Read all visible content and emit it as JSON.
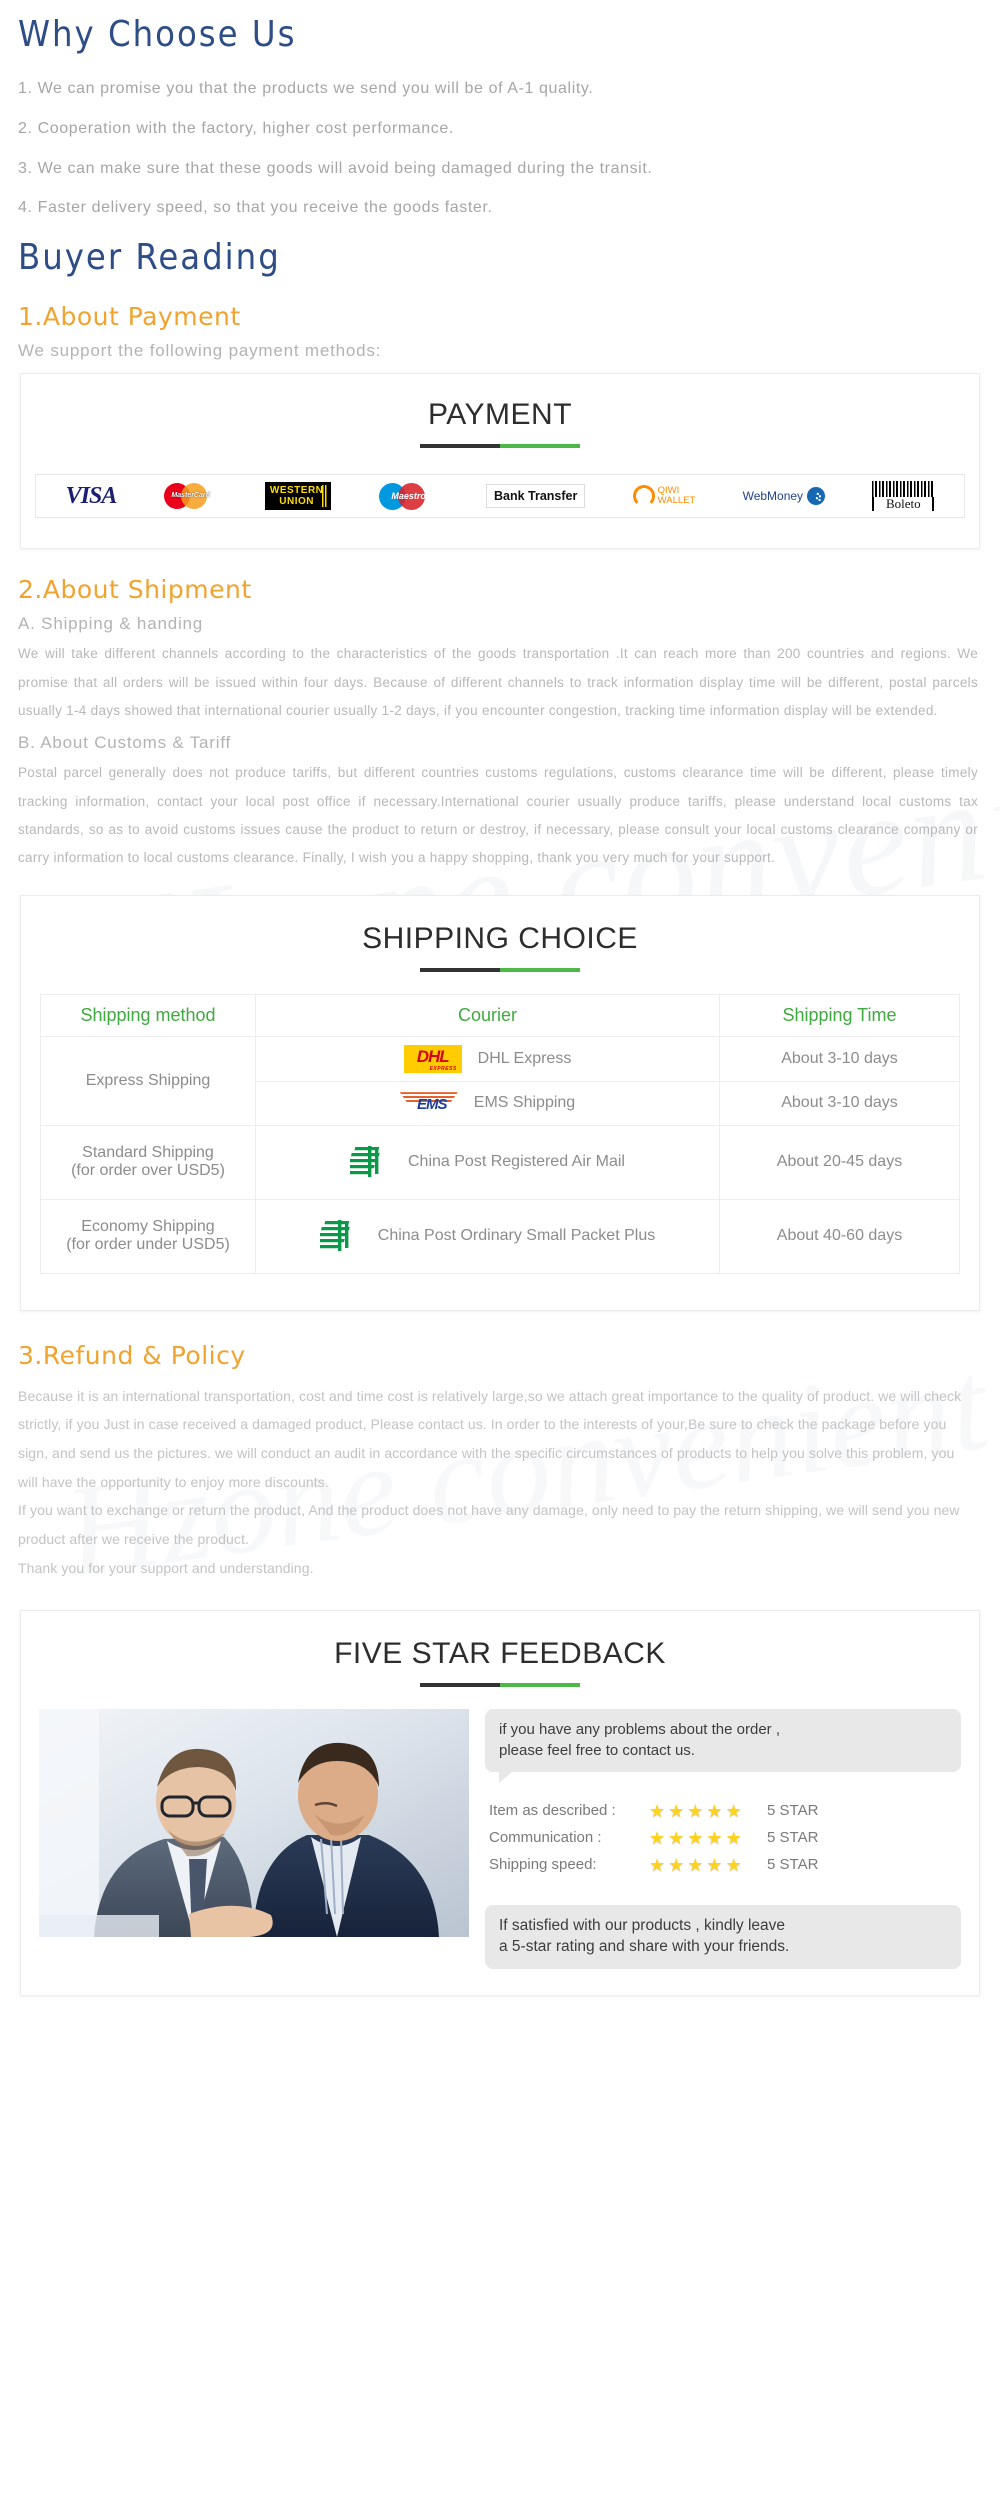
{
  "watermark": {
    "line1": "Hzone convenient life store",
    "line2": "Hzone convenient life store"
  },
  "why_choose_us": {
    "title": "Why Choose Us",
    "items": [
      "1. We can promise you that the products we send you will be of A-1 quality.",
      "2. Cooperation with the factory, higher cost performance.",
      "3. We can make sure that these goods will avoid being damaged during the transit.",
      "4. Faster delivery speed, so that you receive the goods faster."
    ]
  },
  "buyer_reading": {
    "title": "Buyer Reading"
  },
  "payment": {
    "heading": "1.About Payment",
    "intro": "We support the following payment methods:",
    "panel_title": "PAYMENT",
    "methods": [
      {
        "name": "visa-logo",
        "label": "VISA"
      },
      {
        "name": "mastercard-logo",
        "label": "MasterCard"
      },
      {
        "name": "western-union-logo",
        "label_line1": "WESTERN",
        "label_line2": "UNION"
      },
      {
        "name": "maestro-logo",
        "label": "Maestro"
      },
      {
        "name": "bank-transfer-logo",
        "label": "Bank Transfer"
      },
      {
        "name": "qiwi-wallet-logo",
        "label_line1": "QIWI",
        "label_line2": "WALLET"
      },
      {
        "name": "webmoney-logo",
        "label": "WebMoney"
      },
      {
        "name": "boleto-logo",
        "label": "Boleto"
      }
    ]
  },
  "shipment": {
    "heading": "2.About Shipment",
    "section_a_title": "A. Shipping & handing",
    "section_a_text": "We will take different channels according to the characteristics of the goods transportation .It can reach more than 200 countries and regions. We promise that all orders will be issued within four days. Because of different channels to track information display time will be different, postal parcels usually 1-4 days showed that international courier usually 1-2 days, if you encounter congestion, tracking time information display will be extended.",
    "section_b_title": "B. About Customs & Tariff",
    "section_b_text": "Postal parcel generally does not produce tariffs, but different countries customs regulations, customs clearance time will be different, please timely tracking information, contact your local post office if necessary.International courier usually produce tariffs, please understand local customs tax standards, so as to avoid customs issues cause the product to return or destroy, if necessary, please consult your local customs clearance company or carry information to local customs clearance. Finally, I wish you a happy shopping, thank you very much for your support.",
    "panel_title": "SHIPPING CHOICE",
    "table": {
      "headers": [
        "Shipping method",
        "Courier",
        "Shipping Time"
      ],
      "rows": [
        {
          "method": "Express Shipping",
          "method_rowspan": 2,
          "couriers": [
            {
              "logo": "dhl-logo",
              "name": "DHL Express",
              "time": "About 3-10 days"
            },
            {
              "logo": "ems-logo",
              "name": "EMS Shipping",
              "time": "About 3-10 days"
            }
          ]
        },
        {
          "method_line1": "Standard Shipping",
          "method_line2": "(for order over USD5)",
          "couriers": [
            {
              "logo": "china-post-logo",
              "name": "China Post Registered Air Mail",
              "time": "About 20-45 days"
            }
          ]
        },
        {
          "method_line1": "Economy Shipping",
          "method_line2": "(for order under USD5)",
          "couriers": [
            {
              "logo": "china-post-logo",
              "name": "China Post Ordinary Small Packet Plus",
              "time": "About 40-60 days"
            }
          ]
        }
      ]
    }
  },
  "refund": {
    "heading": "3.Refund & Policy",
    "paragraph1": "Because it is an international transportation, cost and time cost is relatively large,so we attach great importance to the quality of product. we will check strictly, if you Just in case received a damaged product, Please contact us. In order to the interests of your,Be sure to check the package before you sign, and send us the pictures. we will conduct an audit in accordance with the specific circumstances of products to help you solve this problem, you will have the opportunity to enjoy more discounts.",
    "paragraph2": "If you want to exchange or return the product, And the product does not have any damage, only need to pay the return shipping, we will send you new product after we receive the product.",
    "paragraph3": "Thank you for your support and understanding."
  },
  "feedback": {
    "panel_title": "FIVE STAR FEEDBACK",
    "bubble_top_line1": "if you have any problems about the order ,",
    "bubble_top_line2": "please feel free to contact us.",
    "ratings": [
      {
        "label": "Item as described :",
        "stars": 5,
        "value": "5 STAR"
      },
      {
        "label": "Communication :",
        "stars": 5,
        "value": "5 STAR"
      },
      {
        "label": "Shipping speed:",
        "stars": 5,
        "value": "5 STAR"
      }
    ],
    "bubble_bottom_line1": "If satisfied with our products ,  kindly leave",
    "bubble_bottom_line2": "a 5-star rating and share with your friends."
  },
  "colors": {
    "heading_blue": "#2e4d86",
    "heading_orange": "#f0a32e",
    "table_header_green": "#3faa3f",
    "rule_green": "#4db848",
    "rule_dark": "#333333",
    "body_gray": "#b3b3b3"
  }
}
